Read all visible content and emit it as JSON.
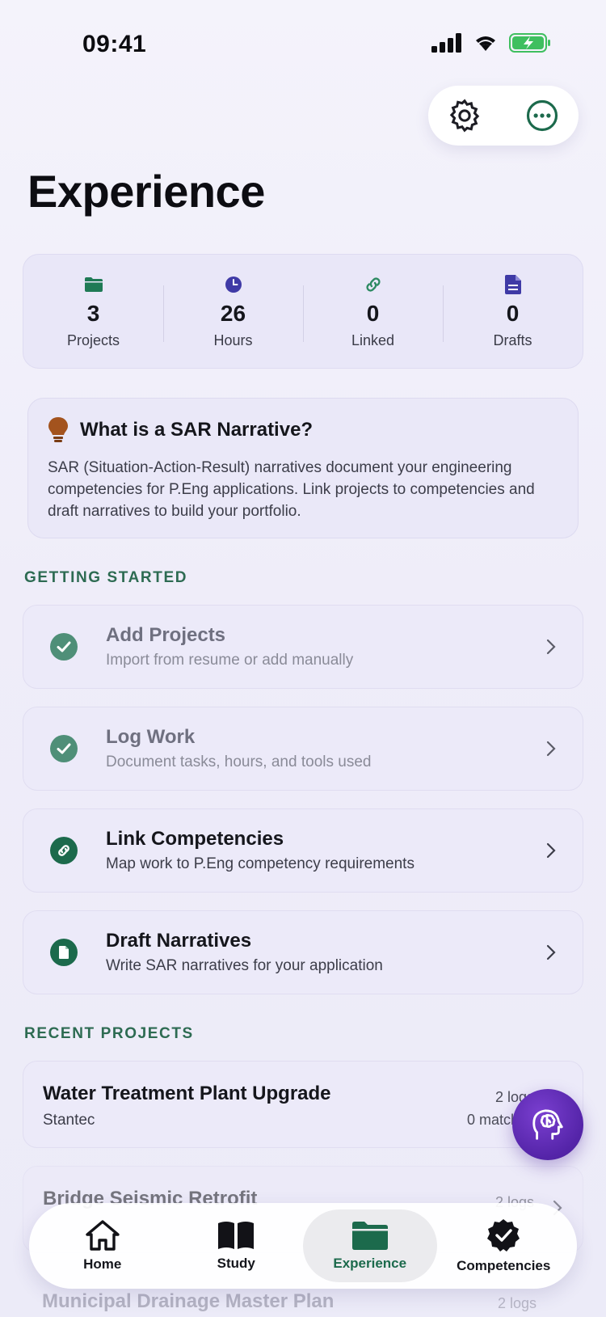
{
  "status_bar": {
    "time": "09:41"
  },
  "header": {
    "title": "Experience",
    "settings_icon": "gear-icon",
    "more_icon": "more-icon"
  },
  "stats": [
    {
      "icon": "folder-icon",
      "value": "3",
      "label": "Projects",
      "color": "#1f7a55"
    },
    {
      "icon": "clock-icon",
      "value": "26",
      "label": "Hours",
      "color": "#3f3aa6"
    },
    {
      "icon": "link-icon",
      "value": "0",
      "label": "Linked",
      "color": "#2d8a62"
    },
    {
      "icon": "document-icon",
      "value": "0",
      "label": "Drafts",
      "color": "#3f3aa6"
    }
  ],
  "info": {
    "icon": "lightbulb-icon",
    "title": "What is a SAR Narrative?",
    "body": "SAR (Situation-Action-Result) narratives document your engineering competencies for P.Eng applications. Link projects to competencies and draft narratives to build your portfolio."
  },
  "getting_started": {
    "label": "GETTING STARTED",
    "steps": [
      {
        "title": "Add Projects",
        "subtitle": "Import from resume or add manually",
        "done": true
      },
      {
        "title": "Log Work",
        "subtitle": "Document tasks, hours, and tools used",
        "done": true
      },
      {
        "title": "Link Competencies",
        "subtitle": "Map work to P.Eng competency requirements",
        "done": false
      },
      {
        "title": "Draft Narratives",
        "subtitle": "Write SAR narratives for your application",
        "done": false
      }
    ]
  },
  "recent_projects": {
    "label": "RECENT PROJECTS",
    "items": [
      {
        "name": "Water Treatment Plant Upgrade",
        "org": "Stantec",
        "logs": "2 logs",
        "matches": "0 matches"
      },
      {
        "name": "Bridge Seismic Retrofit",
        "logs": "2 logs"
      },
      {
        "name": "Municipal Drainage Master Plan",
        "logs": "2 logs"
      }
    ]
  },
  "fab": {
    "icon": "brain-icon"
  },
  "tabs": [
    {
      "label": "Home",
      "icon": "home-icon",
      "active": false
    },
    {
      "label": "Study",
      "icon": "book-icon",
      "active": false
    },
    {
      "label": "Experience",
      "icon": "folder-icon",
      "active": true
    },
    {
      "label": "Competencies",
      "icon": "badge-check-icon",
      "active": false
    }
  ],
  "colors": {
    "accent": "#1c6a4c",
    "done_check": "#4f8f78",
    "fab": "#5424a8"
  }
}
